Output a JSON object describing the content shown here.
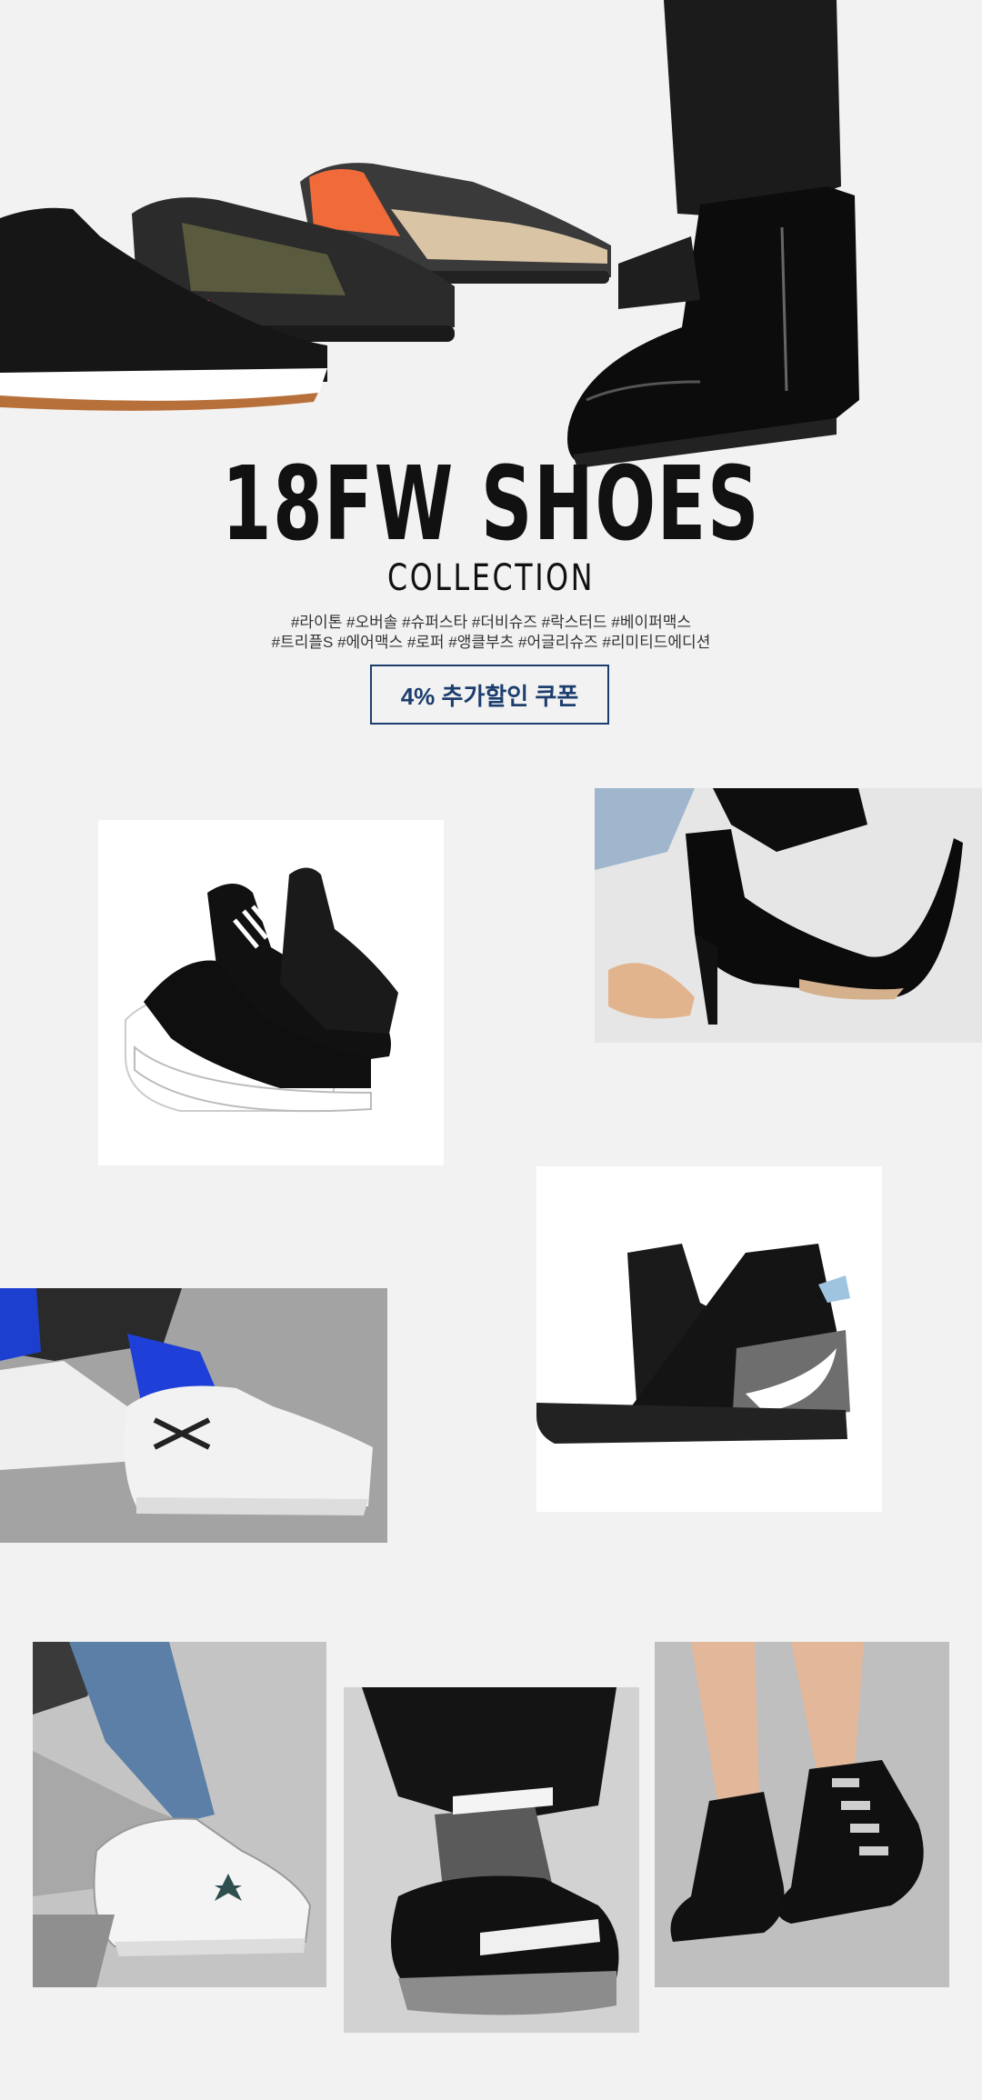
{
  "hero": {
    "title": "18FW SHOES",
    "subtitle": "COLLECTION",
    "tags_line1": "#라이톤 #오버솔 #슈퍼스타 #더비슈즈 #락스터드 #베이퍼맥스",
    "tags_line2": "#트리플S #에어맥스 #로퍼 #앵클부츠 #어글리슈즈 #리미티드에디션",
    "coupon_label": "4% 추가할인 쿠폰"
  },
  "colors": {
    "background": "#f2f2f2",
    "coupon_border": "#1c3e6e",
    "coupon_text": "#1c3e6e",
    "title_text": "#111111"
  },
  "products": [
    {
      "name": "y3-kaiwa-sneaker-photo"
    },
    {
      "name": "stiletto-ankle-boot-photo"
    },
    {
      "name": "street-sock-sneaker-photo"
    },
    {
      "name": "high-top-black-sneaker-photo"
    },
    {
      "name": "white-star-sneaker-photo"
    },
    {
      "name": "strap-chunky-sneaker-photo"
    },
    {
      "name": "buckle-ankle-boot-photo"
    }
  ]
}
